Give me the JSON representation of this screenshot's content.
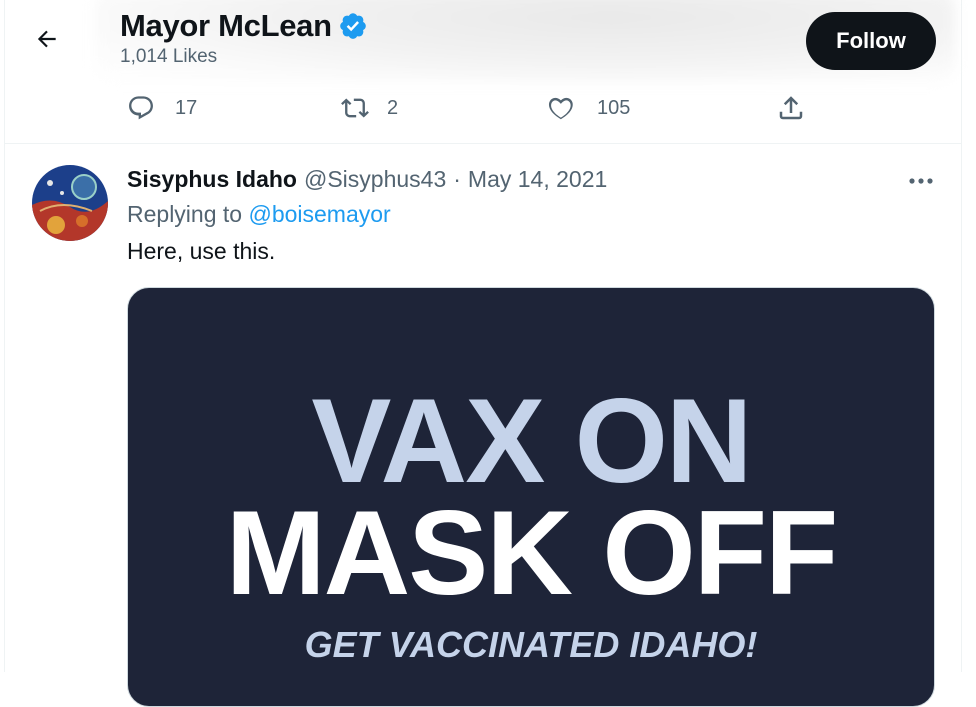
{
  "header": {
    "title": "Mayor McLean",
    "likes": "1,014 Likes",
    "follow_label": "Follow"
  },
  "actions": {
    "replies": "17",
    "retweets": "2",
    "likes": "105"
  },
  "tweet": {
    "display_name": "Sisyphus Idaho",
    "handle": "@Sisyphus43",
    "separator": "·",
    "date": "May 14, 2021",
    "replying_prefix": "Replying to",
    "replying_to": "@boisemayor",
    "text": "Here, use this.",
    "media": {
      "line1": "VAX ON",
      "line2": "MASK OFF",
      "line3": "GET VACCINATED IDAHO!"
    }
  },
  "colors": {
    "accent": "#1d9bf0",
    "secondary_text": "#536471",
    "follow_bg": "#0f1419",
    "media_bg": "#1e2438",
    "media_light_text": "#c5d3ea"
  },
  "icons": [
    "back-arrow-icon",
    "verified-badge-icon",
    "reply-icon",
    "retweet-icon",
    "like-icon",
    "share-icon",
    "more-icon"
  ]
}
